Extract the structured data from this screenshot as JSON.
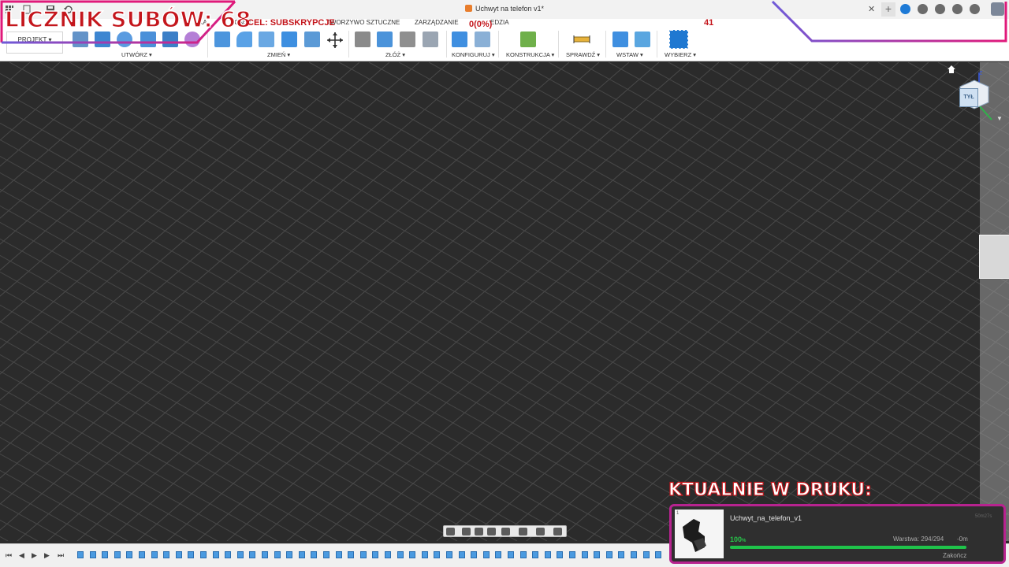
{
  "window": {
    "title": "Uchwyt na telefon v1*"
  },
  "ribbon": {
    "workspace": "PROJEKT",
    "tabs": {
      "surface": "KA",
      "konstr": "KONST",
      "plastic": "TWORZYWO SZTUCZNE",
      "manage": "ZARZĄDZANIE",
      "tools": "EDZIA"
    },
    "groups": {
      "create": "UTWÓRZ ▾",
      "modify": "ZMIEŃ ▾",
      "assemble": "ZŁÓŻ ▾",
      "configure": "KONFIGURUJ ▾",
      "construct": "KONSTRUKCJA ▾",
      "inspect": "SPRAWDŹ ▾",
      "insert": "WSTAW ▾",
      "select": "WYBIERZ ▾"
    }
  },
  "overlay": {
    "sub_counter": "LICZNIK SUBÓW: 68",
    "goal": "CEL: SUBSKRYPCJE",
    "progress": "0(0%)",
    "goal_number": "41",
    "printing_title": "KTUALNIE W DRUKU:"
  },
  "viewcube": {
    "face": "TYŁ",
    "axis_z": "Z"
  },
  "print_job": {
    "index": "1",
    "name": "Uchwyt_na_telefon_v1",
    "elapsed": "50m27s",
    "percent": "100",
    "percent_unit": "%",
    "progress_fraction": 1.0,
    "layers": "Warstwa: 294/294",
    "remaining": "-0m",
    "action": "Zakończ"
  },
  "colors": {
    "accent_red": "#c4161c",
    "neon_pink": "#e0197a",
    "neon_purple": "#6f5ad8",
    "progress_green": "#1fc34a"
  }
}
